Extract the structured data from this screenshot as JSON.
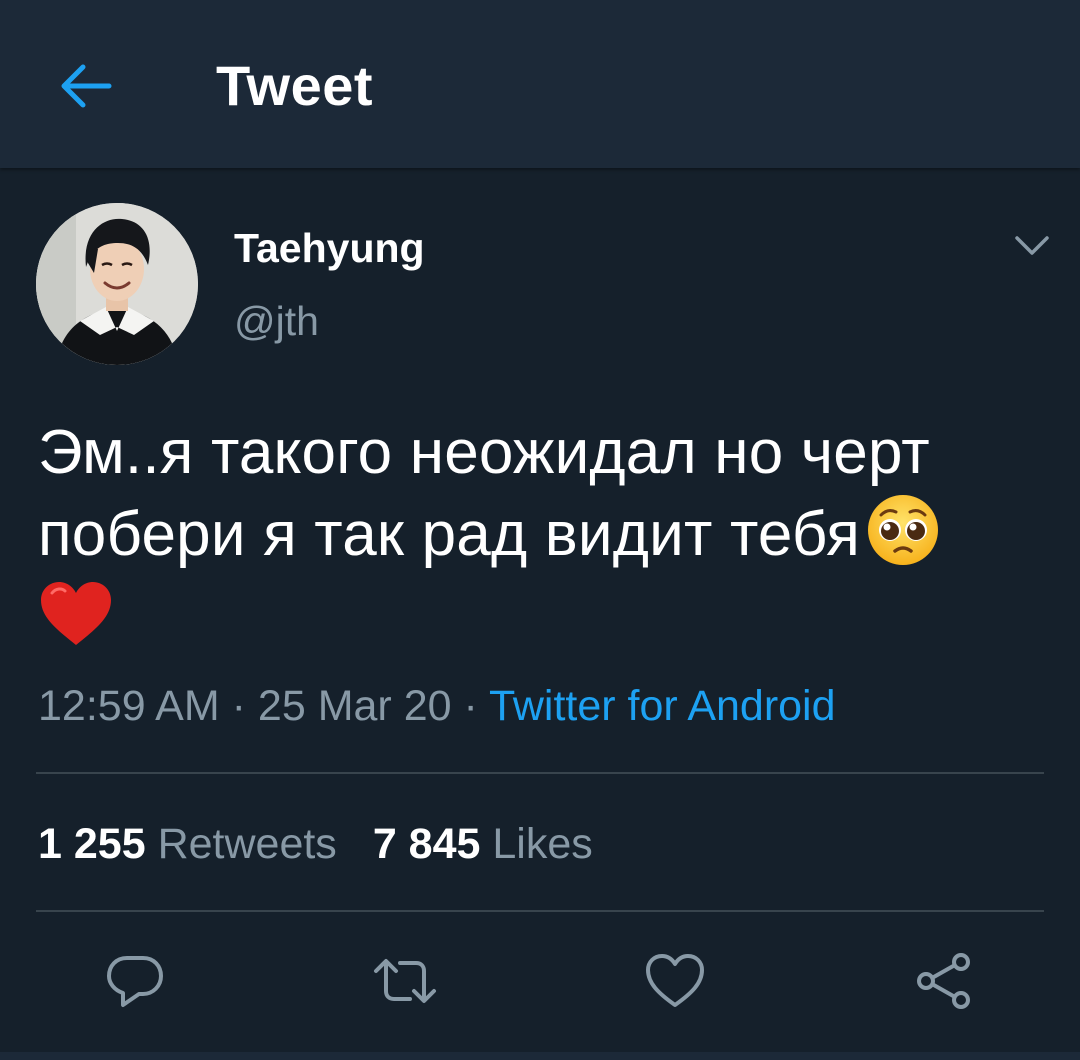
{
  "header": {
    "title": "Tweet",
    "back_icon": "arrow-left-icon"
  },
  "tweet": {
    "author": {
      "display_name": "Taehyung",
      "handle": "@jth",
      "avatar": "avatar-photo"
    },
    "text_line_1": "Эм..я такого неожидал но черт",
    "text_line_2": "побери я так рад видит тебя",
    "emojis": [
      "pleading-face-emoji",
      "red-heart-emoji"
    ],
    "time": "12:59 AM",
    "date": "25 Mar 20",
    "separator": "·",
    "source": "Twitter for Android"
  },
  "stats": {
    "retweets_count": "1 255",
    "retweets_label": "Retweets",
    "likes_count": "7 845",
    "likes_label": "Likes"
  },
  "actions": [
    "reply-icon",
    "retweet-icon",
    "like-icon",
    "share-icon"
  ],
  "colors": {
    "background": "#15202b",
    "header_background": "#1c2938",
    "accent": "#1da1f2",
    "secondary_text": "#8899a6",
    "divider": "#38444d"
  }
}
